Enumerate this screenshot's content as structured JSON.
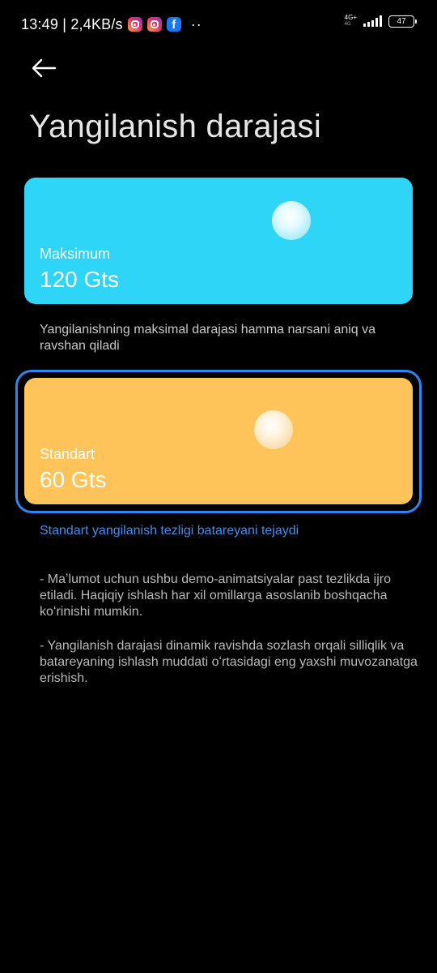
{
  "status_bar": {
    "time_speed": "13:49 | 2,4KB/s",
    "more": "··",
    "network_top": "4G+",
    "network_bottom": "4G",
    "battery": "47",
    "app_icons": [
      "instagram-icon",
      "instagram-icon",
      "facebook-icon"
    ]
  },
  "header": {
    "back_icon": "arrow-left-icon",
    "title": "Yangilanish darajasi"
  },
  "options": [
    {
      "label": "Maksimum",
      "value": "120 Gts",
      "description": "Yangilanishning maksimal darajasi hamma narsani aniq va ravshan qiladi",
      "color": "#2fd5f7",
      "selected": false
    },
    {
      "label": "Standart",
      "value": "60 Gts",
      "description": "Standart yangilanish tezligi batareyani tejaydi",
      "color": "#fec45a",
      "selected": true
    }
  ],
  "notes": [
    "- Maʼlumot uchun ushbu demo-animatsiyalar past tezlikda ijro etiladi. Haqiqiy ishlash har xil omillarga asoslanib boshqacha koʻrinishi mumkin.",
    "- Yangilanish darajasi dinamik ravishda sozlash orqali silliqlik va batareyaning ishlash muddati oʻrtasidagi eng yaxshi muvozanatga erishish."
  ],
  "colors": {
    "background": "#000000",
    "accent": "#2e84f0",
    "selected_description": "#3d8ff2"
  }
}
